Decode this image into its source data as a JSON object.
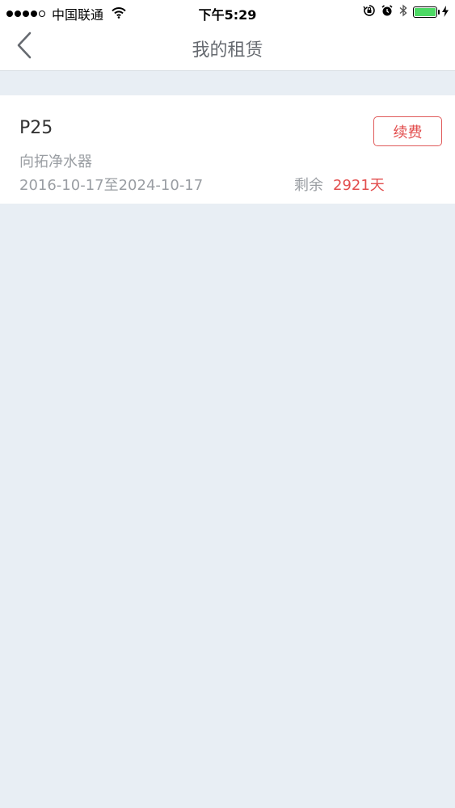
{
  "status_bar": {
    "carrier": "中国联通",
    "time": "下午5:29",
    "battery_level": 1.0,
    "battery_color": "#4cd964"
  },
  "nav": {
    "back_icon": "chevron-left-icon",
    "title": "我的租赁"
  },
  "rental": {
    "model": "P25",
    "product_name": "向拓净水器",
    "period": "2016-10-17至2024-10-17",
    "remaining_label": "剩余",
    "remaining_value": "2921天",
    "renew_label": "续费",
    "accent_color": "#e24d4d"
  }
}
